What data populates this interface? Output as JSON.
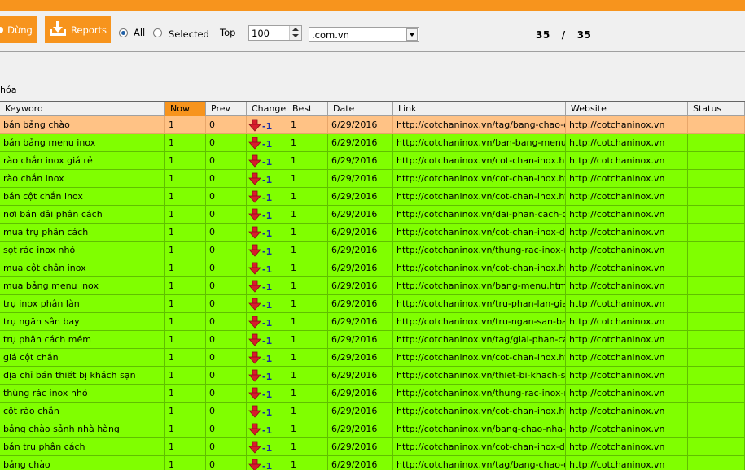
{
  "toolbar": {
    "stop_label": "Dừng",
    "reports_label": "Reports",
    "radio_all": "All",
    "radio_selected": "Selected",
    "top_label": "Top",
    "top_value": "100",
    "domain_value": ".com.vn",
    "count_current": "35",
    "count_sep": "/",
    "count_total": "35"
  },
  "tab_label": "hóa",
  "columns": [
    "Keyword",
    "Now",
    "Prev",
    "Change",
    "Best",
    "Date",
    "Link",
    "Website",
    "Status"
  ],
  "rows": [
    {
      "keyword": "bán bảng chào",
      "now": "1",
      "prev": "0",
      "change": "-1",
      "best": "1",
      "date": "6/29/2016",
      "link": "http://cotchaninox.vn/tag/bang-chao-do...",
      "website": "http://cotchaninox.vn",
      "status": ""
    },
    {
      "keyword": "bán bảng menu inox",
      "now": "1",
      "prev": "0",
      "change": "-1",
      "best": "1",
      "date": "6/29/2016",
      "link": "http://cotchaninox.vn/ban-bang-menu-in...",
      "website": "http://cotchaninox.vn",
      "status": ""
    },
    {
      "keyword": "rào chắn inox giá rẻ",
      "now": "1",
      "prev": "0",
      "change": "-1",
      "best": "1",
      "date": "6/29/2016",
      "link": "http://cotchaninox.vn/cot-chan-inox.html",
      "website": "http://cotchaninox.vn",
      "status": ""
    },
    {
      "keyword": "rào chắn inox",
      "now": "1",
      "prev": "0",
      "change": "-1",
      "best": "1",
      "date": "6/29/2016",
      "link": "http://cotchaninox.vn/cot-chan-inox.html",
      "website": "http://cotchaninox.vn",
      "status": ""
    },
    {
      "keyword": "bán cột chắn inox",
      "now": "1",
      "prev": "0",
      "change": "-1",
      "best": "1",
      "date": "6/29/2016",
      "link": "http://cotchaninox.vn/cot-chan-inox.html",
      "website": "http://cotchaninox.vn",
      "status": ""
    },
    {
      "keyword": "nơi bán dải phân cách",
      "now": "1",
      "prev": "0",
      "change": "-1",
      "best": "1",
      "date": "6/29/2016",
      "link": "http://cotchaninox.vn/dai-phan-cach-di-...",
      "website": "http://cotchaninox.vn",
      "status": ""
    },
    {
      "keyword": "mua trụ phân cách",
      "now": "1",
      "prev": "0",
      "change": "-1",
      "best": "1",
      "date": "6/29/2016",
      "link": "http://cotchaninox.vn/cot-chan-inox-day...",
      "website": "http://cotchaninox.vn",
      "status": ""
    },
    {
      "keyword": "sọt rác inox nhỏ",
      "now": "1",
      "prev": "0",
      "change": "-1",
      "best": "1",
      "date": "6/29/2016",
      "link": "http://cotchaninox.vn/thung-rac-inox-nh...",
      "website": "http://cotchaninox.vn",
      "status": ""
    },
    {
      "keyword": "mua cột chắn inox",
      "now": "1",
      "prev": "0",
      "change": "-1",
      "best": "1",
      "date": "6/29/2016",
      "link": "http://cotchaninox.vn/cot-chan-inox.html",
      "website": "http://cotchaninox.vn",
      "status": ""
    },
    {
      "keyword": "mua bảng menu inox",
      "now": "1",
      "prev": "0",
      "change": "-1",
      "best": "1",
      "date": "6/29/2016",
      "link": "http://cotchaninox.vn/bang-menu.html",
      "website": "http://cotchaninox.vn",
      "status": ""
    },
    {
      "keyword": "trụ inox phân làn",
      "now": "1",
      "prev": "0",
      "change": "-1",
      "best": "1",
      "date": "6/29/2016",
      "link": "http://cotchaninox.vn/tru-phan-lan-giao-t...",
      "website": "http://cotchaninox.vn",
      "status": ""
    },
    {
      "keyword": "trụ ngăn sân bay",
      "now": "1",
      "prev": "0",
      "change": "-1",
      "best": "1",
      "date": "6/29/2016",
      "link": "http://cotchaninox.vn/tru-ngan-san-bay....",
      "website": "http://cotchaninox.vn",
      "status": ""
    },
    {
      "keyword": "trụ phân cách mềm",
      "now": "1",
      "prev": "0",
      "change": "-1",
      "best": "1",
      "date": "6/29/2016",
      "link": "http://cotchaninox.vn/tag/giai-phan-cac...",
      "website": "http://cotchaninox.vn",
      "status": ""
    },
    {
      "keyword": "giá cột chắn",
      "now": "1",
      "prev": "0",
      "change": "-1",
      "best": "1",
      "date": "6/29/2016",
      "link": "http://cotchaninox.vn/cot-chan-inox.html",
      "website": "http://cotchaninox.vn",
      "status": ""
    },
    {
      "keyword": "địa chỉ bán thiết bị khách sạn",
      "now": "1",
      "prev": "0",
      "change": "-1",
      "best": "1",
      "date": "6/29/2016",
      "link": "http://cotchaninox.vn/thiet-bi-khach-san...",
      "website": "http://cotchaninox.vn",
      "status": ""
    },
    {
      "keyword": "thùng rác inox nhỏ",
      "now": "1",
      "prev": "0",
      "change": "-1",
      "best": "1",
      "date": "6/29/2016",
      "link": "http://cotchaninox.vn/thung-rac-inox-nh...",
      "website": "http://cotchaninox.vn",
      "status": ""
    },
    {
      "keyword": "cột rào chắn",
      "now": "1",
      "prev": "0",
      "change": "-1",
      "best": "1",
      "date": "6/29/2016",
      "link": "http://cotchaninox.vn/cot-chan-inox.html",
      "website": "http://cotchaninox.vn",
      "status": ""
    },
    {
      "keyword": "bảng chào sảnh nhà hàng",
      "now": "1",
      "prev": "0",
      "change": "-1",
      "best": "1",
      "date": "6/29/2016",
      "link": "http://cotchaninox.vn/bang-chao-nha-h...",
      "website": "http://cotchaninox.vn",
      "status": ""
    },
    {
      "keyword": "bán trụ phân cách",
      "now": "1",
      "prev": "0",
      "change": "-1",
      "best": "1",
      "date": "6/29/2016",
      "link": "http://cotchaninox.vn/cot-chan-inox-day...",
      "website": "http://cotchaninox.vn",
      "status": ""
    },
    {
      "keyword": "bảng chào",
      "now": "1",
      "prev": "0",
      "change": "-1",
      "best": "1",
      "date": "6/29/2016",
      "link": "http://cotchaninox.vn/tag/bang-chao-do...",
      "website": "http://cotchaninox.vn",
      "status": ""
    }
  ],
  "colors": {
    "accent": "#f7941d",
    "row_bg": "#80ff00",
    "selected_row_bg": "#ffc285",
    "change_text": "#1a2aa8",
    "down_arrow": "#d81c2c"
  },
  "icons": {
    "reports": "download-icon",
    "change": "down-arrow-icon"
  }
}
